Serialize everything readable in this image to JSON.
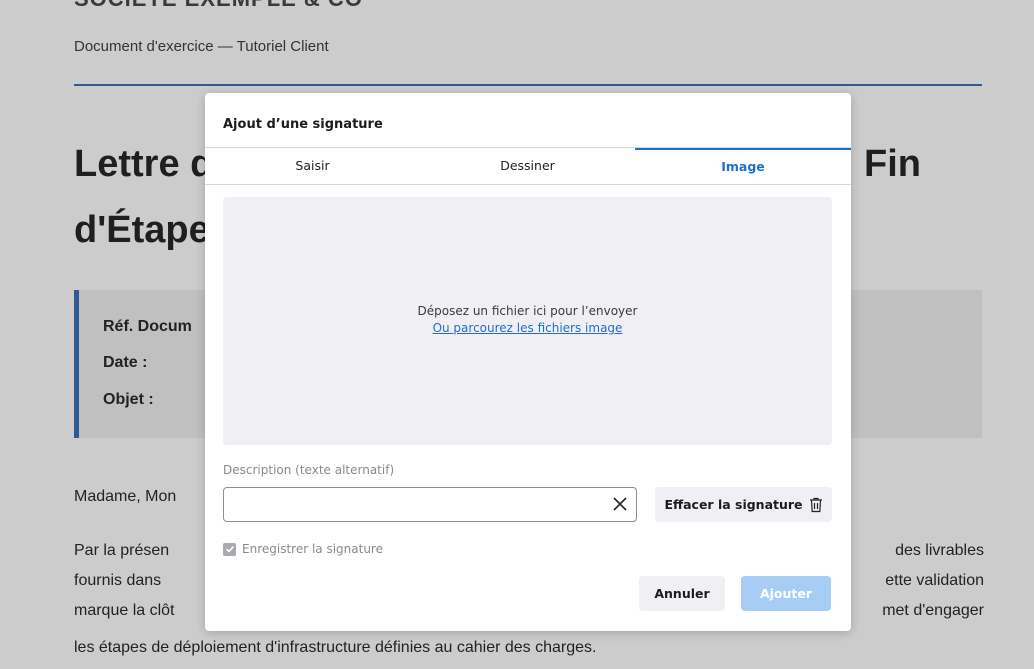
{
  "document": {
    "company_fragment": "SOCIÉTÉ EXEMPLE & CO",
    "subtitle": "Document d'exercice — Tutoriel Client",
    "title_part1": "Lettre d",
    "title_part2": "d'Étape",
    "title_part3": "Fin",
    "info_labels": [
      "Réf. Docum",
      "Date :",
      "Objet :"
    ],
    "greeting": "Madame, Mon",
    "para_lines": [
      {
        "left": "Par la présen",
        "right": "des livrables"
      },
      {
        "left": "fournis dans",
        "right": "ette validation"
      },
      {
        "left": "marque la clôt",
        "right": "met d'engager"
      }
    ],
    "last_line": "les étapes de déploiement d'infrastructure définies au cahier des charges."
  },
  "modal": {
    "title": "Ajout d’une signature",
    "tabs": [
      {
        "label": "Saisir",
        "active": false
      },
      {
        "label": "Dessiner",
        "active": false
      },
      {
        "label": "Image",
        "active": true
      }
    ],
    "dropzone_text": "Déposez un fichier ici pour l’envoyer",
    "dropzone_link": "Ou parcourez les fichiers image",
    "description_label": "Description (texte alternatif)",
    "description_value": "",
    "clear_icon": "close-icon",
    "erase_label": "Effacer la signature",
    "erase_icon": "trash-icon",
    "save_label": "Enregistrer la signature",
    "save_checked": true,
    "cancel_label": "Annuler",
    "add_label": "Ajouter"
  },
  "colors": {
    "accent": "#1f6fd1",
    "doc_rule": "#2f5a93",
    "overlay": "#cccccc",
    "add_disabled": "#a8cdf5"
  }
}
